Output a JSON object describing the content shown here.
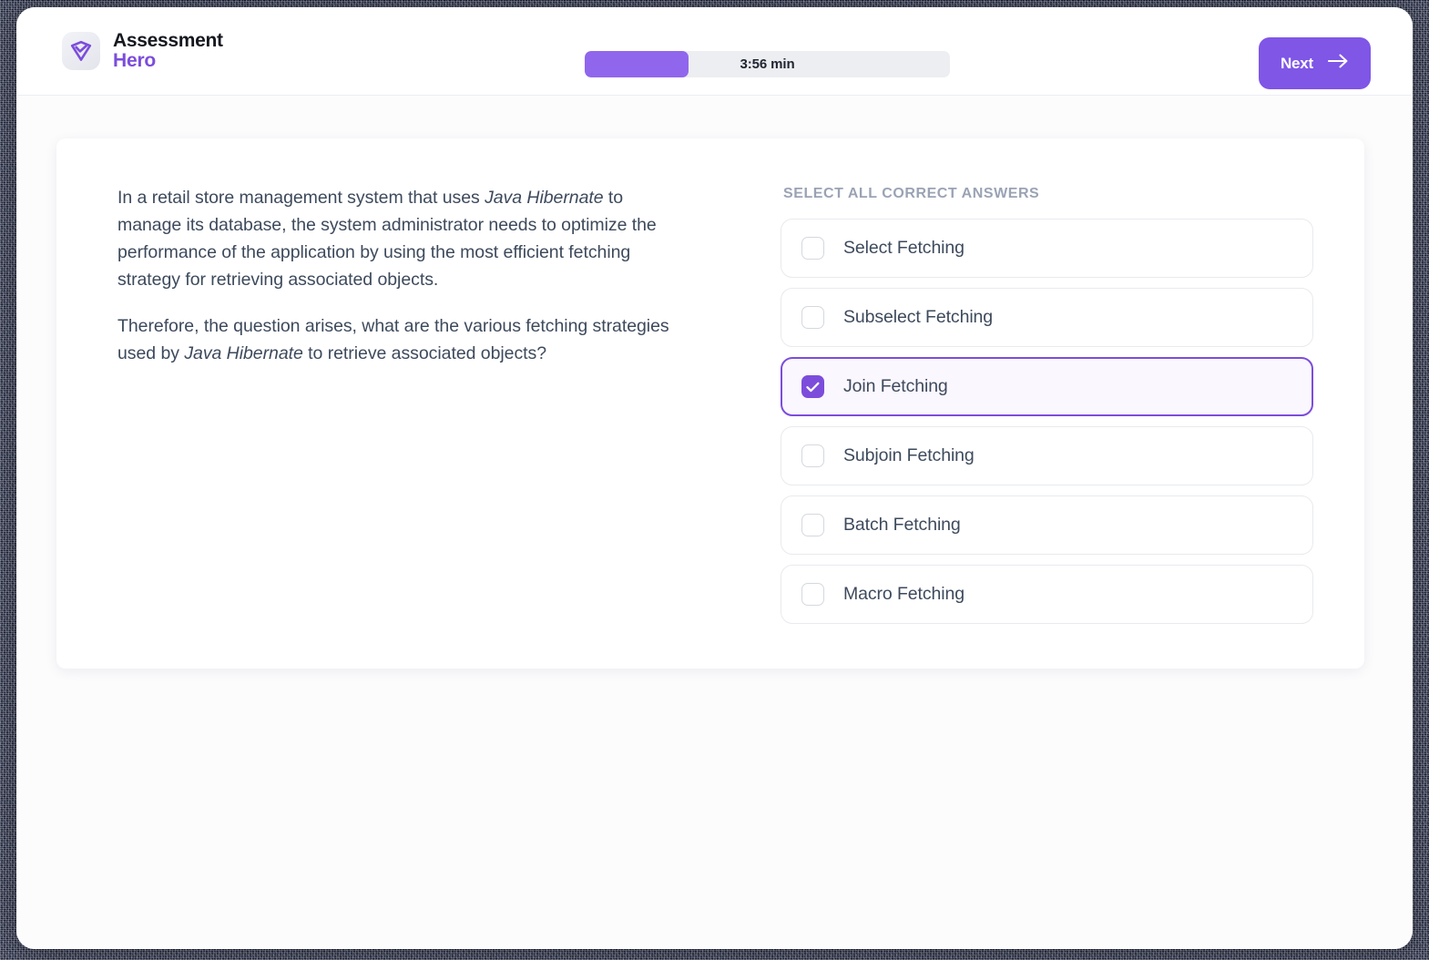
{
  "brand": {
    "logo_icon": "shield-check-logo-icon",
    "line1": "Assessment",
    "line2": "Hero"
  },
  "header": {
    "timer": {
      "label": "3:56 min",
      "progress_percent": 28.5,
      "fill_color": "#9066ed",
      "track_color": "#eceef1"
    },
    "next_button": {
      "label": "Next",
      "icon": "arrow-right-icon",
      "color": "#7f56e6"
    }
  },
  "question": {
    "paragraph1_part1": "In a retail store management system that uses ",
    "paragraph1_emphasis": "Java Hibernate",
    "paragraph1_part2": " to manage its database, the system administrator needs to optimize the performance of the application by using the most efficient fetching strategy for retrieving associated objects.",
    "paragraph2_part1": "Therefore, the question arises, what are the various fetching strategies used by ",
    "paragraph2_emphasis": "Java Hibernate",
    "paragraph2_part2": " to retrieve associated objects?"
  },
  "answers": {
    "heading": "SELECT ALL CORRECT ANSWERS",
    "selected_color": "#7c4ddb",
    "options": [
      {
        "label": "Select Fetching",
        "checked": false
      },
      {
        "label": "Subselect Fetching",
        "checked": false
      },
      {
        "label": "Join Fetching",
        "checked": true
      },
      {
        "label": "Subjoin Fetching",
        "checked": false
      },
      {
        "label": "Batch Fetching",
        "checked": false
      },
      {
        "label": "Macro Fetching",
        "checked": false
      }
    ]
  }
}
